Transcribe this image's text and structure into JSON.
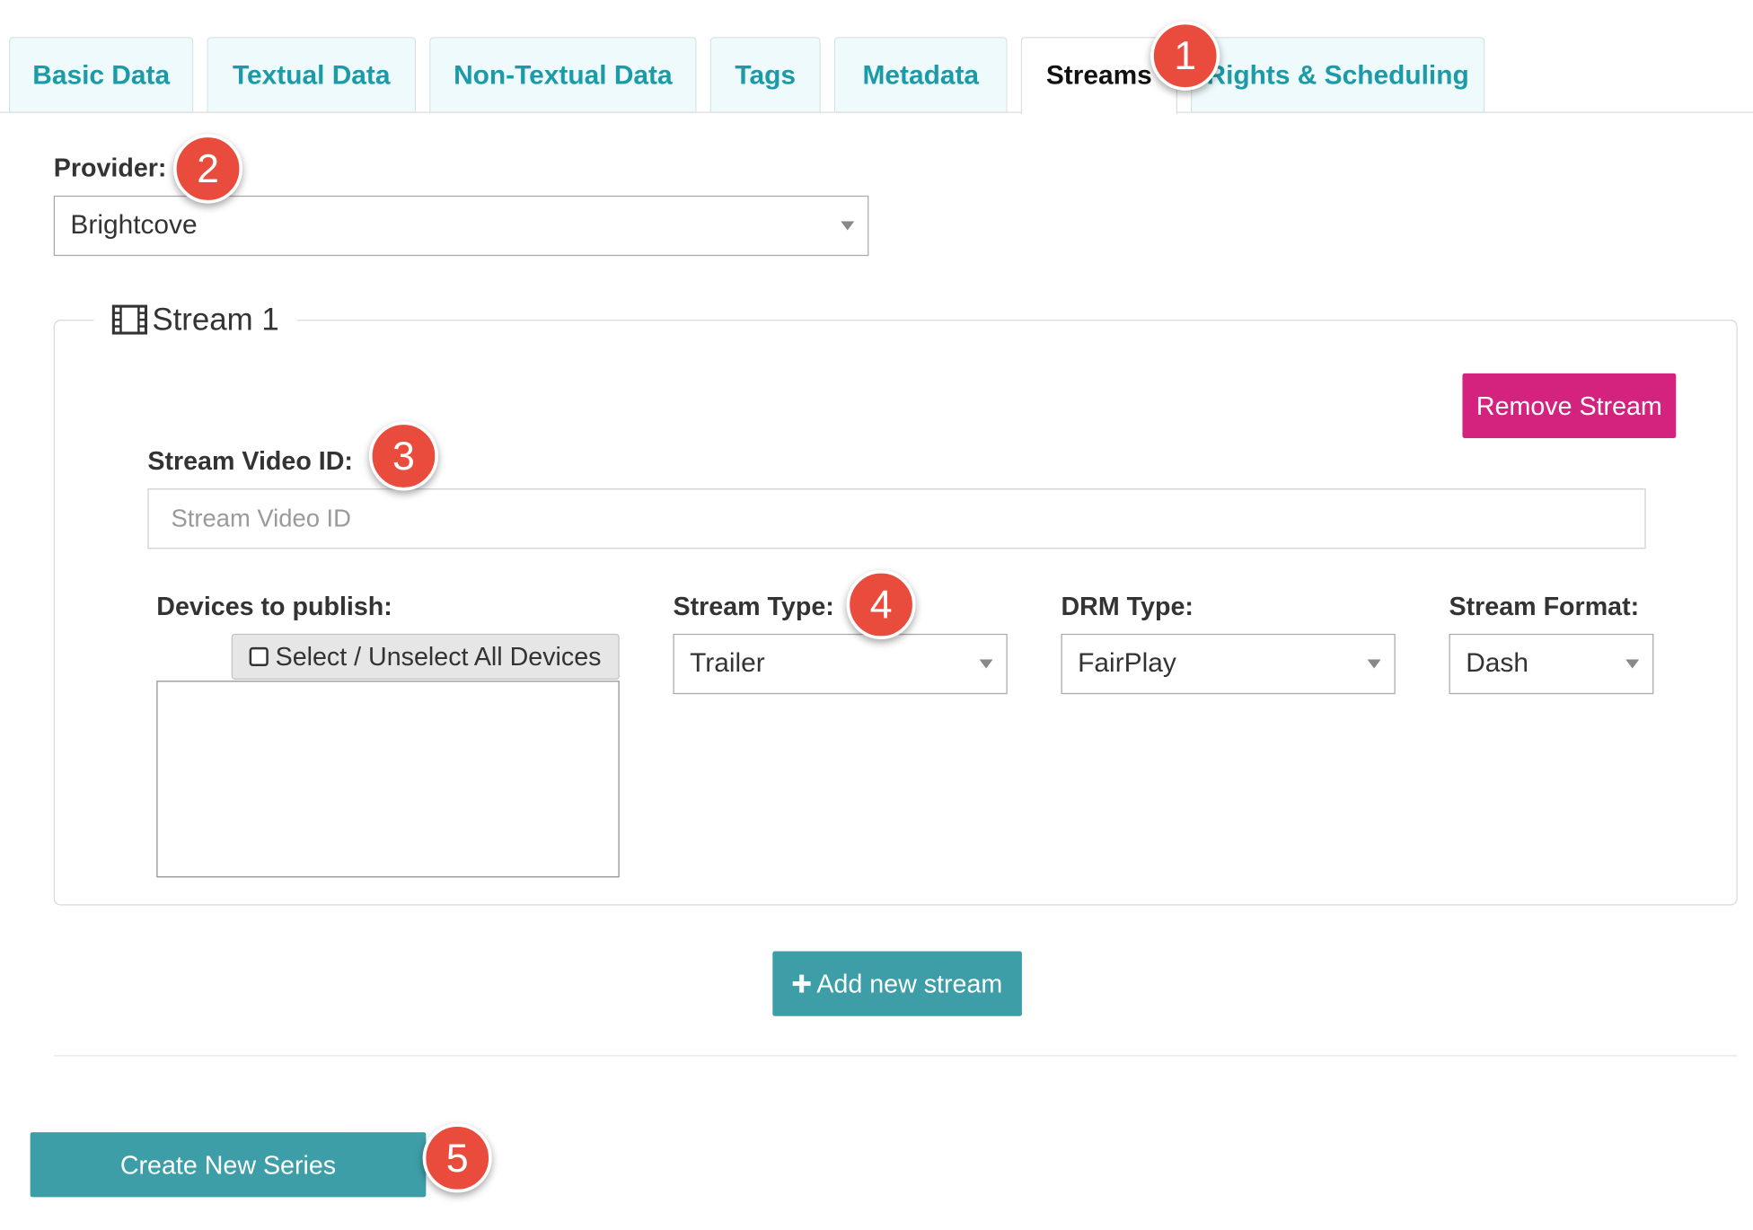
{
  "tabs": [
    {
      "label": "Basic Data"
    },
    {
      "label": "Textual Data"
    },
    {
      "label": "Non-Textual Data"
    },
    {
      "label": "Tags"
    },
    {
      "label": "Metadata"
    },
    {
      "label": "Streams",
      "active": true
    },
    {
      "label": "Rights & Scheduling"
    }
  ],
  "provider": {
    "label": "Provider:",
    "value": "Brightcove"
  },
  "stream": {
    "legend": "Stream 1",
    "remove_label": "Remove Stream",
    "video_id_label": "Stream Video ID:",
    "video_id_placeholder": "Stream Video ID",
    "video_id_value": "",
    "devices_label": "Devices to publish:",
    "devices_toggle_label": "Select / Unselect All Devices",
    "stream_type_label": "Stream Type:",
    "stream_type_value": "Trailer",
    "drm_type_label": "DRM Type:",
    "drm_type_value": "FairPlay",
    "stream_format_label": "Stream Format:",
    "stream_format_value": "Dash"
  },
  "add_stream_label": "Add new stream",
  "create_label": "Create New Series",
  "annotations": [
    "1",
    "2",
    "3",
    "4",
    "5"
  ],
  "colors": {
    "accent": "#3e9ea8",
    "tab_text": "#1c9aa8",
    "danger": "#d4237f",
    "badge": "#e94b3c"
  }
}
